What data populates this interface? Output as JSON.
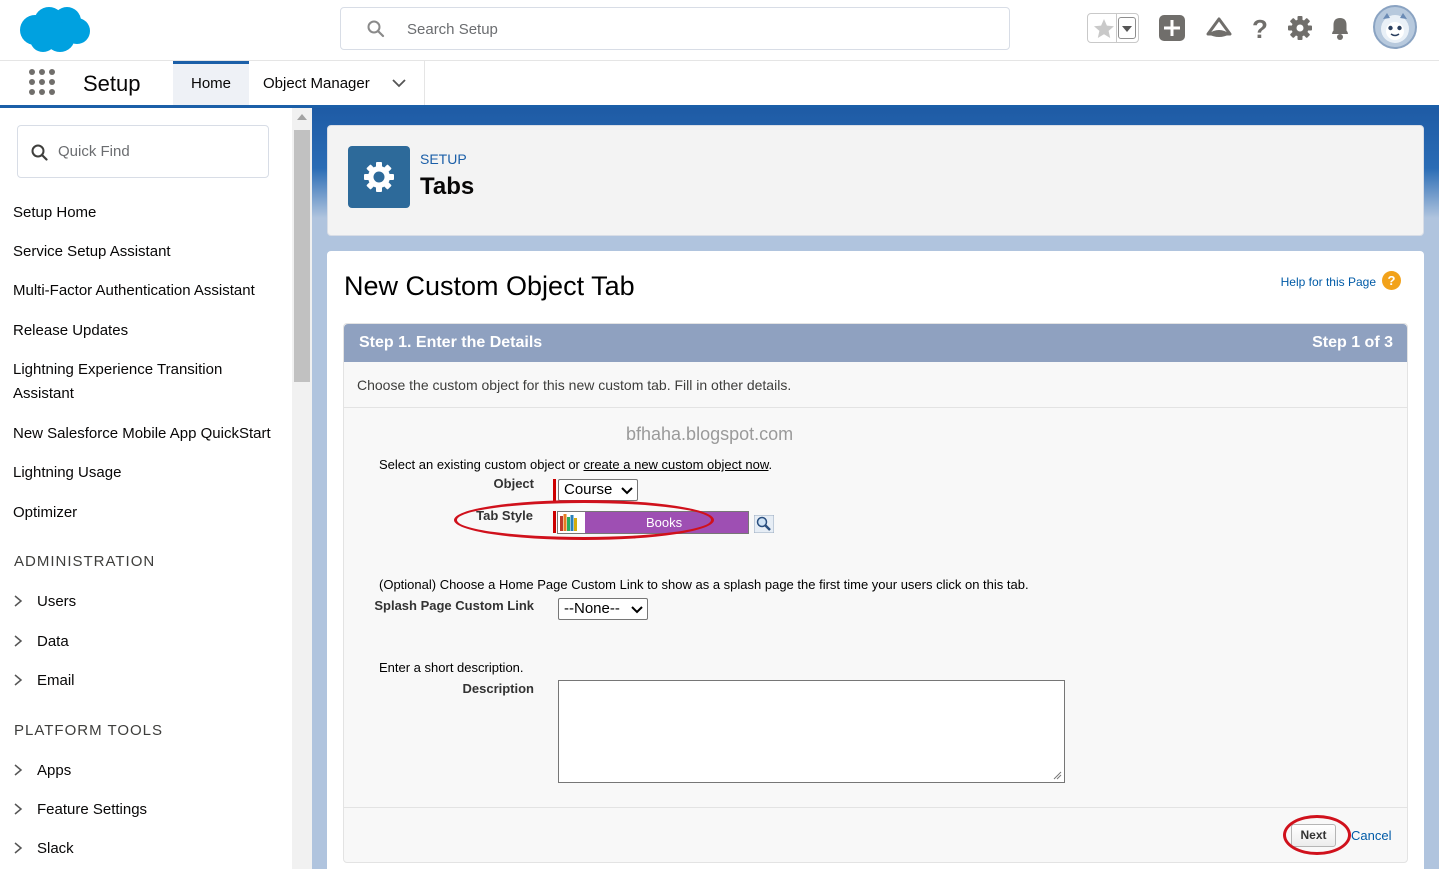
{
  "global_header": {
    "search_placeholder": "Search Setup"
  },
  "context_bar": {
    "app_name": "Setup",
    "tabs": [
      {
        "label": "Home",
        "active": true
      },
      {
        "label": "Object Manager",
        "active": false
      }
    ]
  },
  "sidebar": {
    "quick_find_placeholder": "Quick Find",
    "items": [
      "Setup Home",
      "Service Setup Assistant",
      "Multi-Factor Authentication Assistant",
      "Release Updates",
      "Lightning Experience Transition Assistant",
      "New Salesforce Mobile App QuickStart",
      "Lightning Usage",
      "Optimizer"
    ],
    "sections": [
      {
        "title": "ADMINISTRATION",
        "items": [
          "Users",
          "Data",
          "Email"
        ]
      },
      {
        "title": "PLATFORM TOOLS",
        "items": [
          "Apps",
          "Feature Settings",
          "Slack"
        ]
      }
    ]
  },
  "setup_header": {
    "eyebrow": "SETUP",
    "title": "Tabs"
  },
  "page": {
    "title": "New Custom Object Tab",
    "help_link": "Help for this Page",
    "help_icon": "?"
  },
  "step": {
    "label": "Step 1. Enter the Details",
    "count": "Step 1 of 3",
    "description": "Choose the custom object for this new custom tab. Fill in other details."
  },
  "form": {
    "watermark": "bfhaha.blogspot.com",
    "object_intro_prefix": "Select an existing custom object or ",
    "object_intro_link": "create a new custom object now",
    "object_intro_suffix": ".",
    "object_label": "Object",
    "object_value": "Course",
    "tab_style_label": "Tab Style",
    "tab_style_value": "Books",
    "splash_intro": "(Optional) Choose a Home Page Custom Link to show as a splash page the first time your users click on this tab.",
    "splash_label": "Splash Page Custom Link",
    "splash_value": "--None--",
    "desc_intro": "Enter a short description.",
    "desc_label": "Description",
    "desc_value": ""
  },
  "buttons": {
    "next": "Next",
    "cancel": "Cancel"
  },
  "colors": {
    "brand_blue": "#1b5fa8",
    "step_bar": "#8fa1c0",
    "tab_style_purple": "#9e4fb3",
    "annotation_red": "#d0111c"
  }
}
